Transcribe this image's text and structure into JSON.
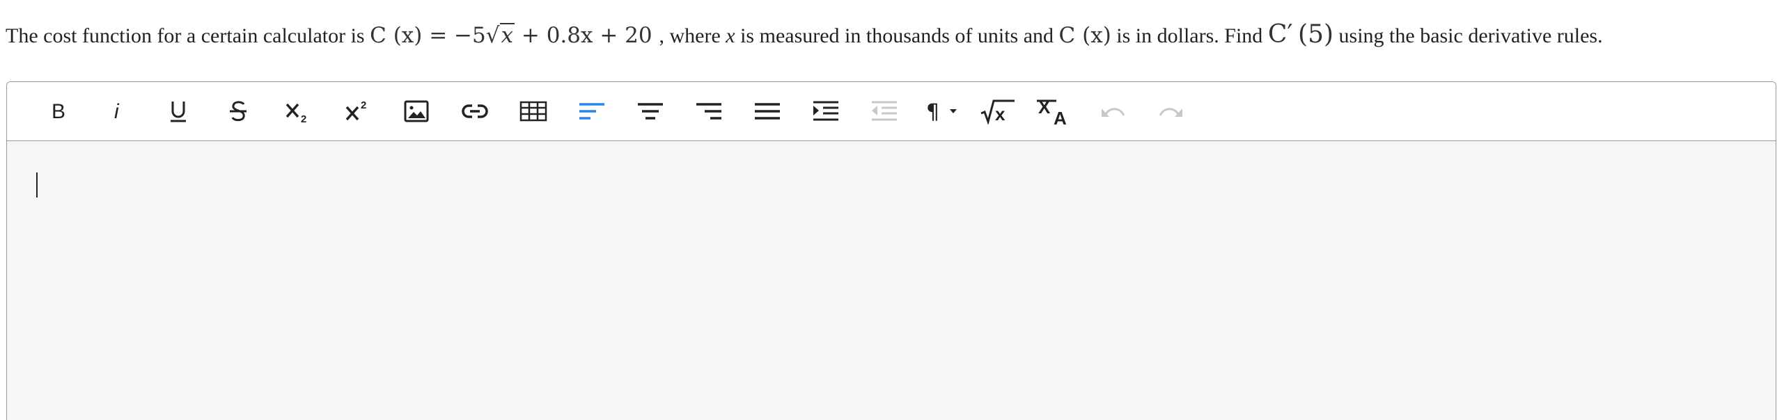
{
  "question": {
    "part1": "The cost function for a certain calculator is",
    "part2": ", where",
    "part3": "is measured in thousands of units and",
    "part4": "is in dollars. Find",
    "part5": "using the basic derivative rules.",
    "var_x": "x",
    "formula": {
      "lhs": "C (x) = −5",
      "radicand": "x",
      "rhs": "+ 0.8x + 20"
    },
    "c_of_x": "C (x)",
    "c_prime": "C′",
    "c_prime_arg": "(5)"
  },
  "toolbar": {
    "buttons": [
      {
        "name": "bold-button",
        "icon": "bold-icon"
      },
      {
        "name": "italic-button",
        "icon": "italic-icon"
      },
      {
        "name": "underline-button",
        "icon": "underline-icon"
      },
      {
        "name": "strikethrough-button",
        "icon": "strikethrough-icon"
      },
      {
        "name": "subscript-button",
        "icon": "subscript-icon"
      },
      {
        "name": "superscript-button",
        "icon": "superscript-icon"
      },
      {
        "name": "insert-image-button",
        "icon": "image-icon"
      },
      {
        "name": "insert-link-button",
        "icon": "link-icon"
      },
      {
        "name": "insert-table-button",
        "icon": "table-icon"
      },
      {
        "name": "align-left-button",
        "icon": "align-left-icon",
        "active": true
      },
      {
        "name": "align-center-button",
        "icon": "align-center-icon"
      },
      {
        "name": "align-right-button",
        "icon": "align-right-icon"
      },
      {
        "name": "align-justify-button",
        "icon": "align-justify-icon"
      },
      {
        "name": "indent-button",
        "icon": "indent-icon"
      },
      {
        "name": "outdent-button",
        "icon": "outdent-icon",
        "disabled": true
      },
      {
        "name": "paragraph-format-button",
        "icon": "pilcrow-dropdown-icon"
      },
      {
        "name": "math-button",
        "icon": "square-root-icon"
      },
      {
        "name": "clear-formatting-button",
        "icon": "clear-format-icon"
      },
      {
        "name": "undo-button",
        "icon": "undo-icon",
        "disabled": true
      },
      {
        "name": "redo-button",
        "icon": "redo-icon",
        "disabled": true
      }
    ]
  },
  "editor": {
    "content": ""
  },
  "colors": {
    "accent": "#2a86e8",
    "icon": "#222222",
    "disabled_icon": "#c8c8c8",
    "border": "#9a9a9a",
    "editor_bg": "#f6f6f6"
  }
}
